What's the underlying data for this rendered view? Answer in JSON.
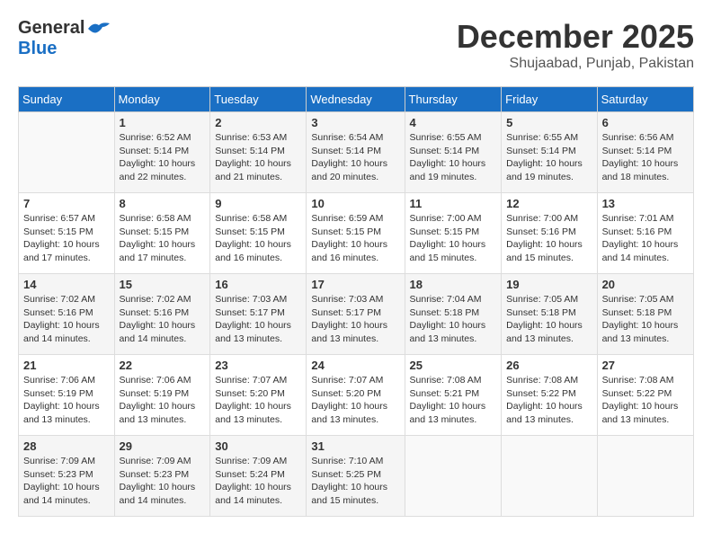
{
  "header": {
    "logo_general": "General",
    "logo_blue": "Blue",
    "month_title": "December 2025",
    "location": "Shujaabad, Punjab, Pakistan"
  },
  "days_of_week": [
    "Sunday",
    "Monday",
    "Tuesday",
    "Wednesday",
    "Thursday",
    "Friday",
    "Saturday"
  ],
  "weeks": [
    [
      {
        "day": "",
        "info": ""
      },
      {
        "day": "1",
        "info": "Sunrise: 6:52 AM\nSunset: 5:14 PM\nDaylight: 10 hours\nand 22 minutes."
      },
      {
        "day": "2",
        "info": "Sunrise: 6:53 AM\nSunset: 5:14 PM\nDaylight: 10 hours\nand 21 minutes."
      },
      {
        "day": "3",
        "info": "Sunrise: 6:54 AM\nSunset: 5:14 PM\nDaylight: 10 hours\nand 20 minutes."
      },
      {
        "day": "4",
        "info": "Sunrise: 6:55 AM\nSunset: 5:14 PM\nDaylight: 10 hours\nand 19 minutes."
      },
      {
        "day": "5",
        "info": "Sunrise: 6:55 AM\nSunset: 5:14 PM\nDaylight: 10 hours\nand 19 minutes."
      },
      {
        "day": "6",
        "info": "Sunrise: 6:56 AM\nSunset: 5:14 PM\nDaylight: 10 hours\nand 18 minutes."
      }
    ],
    [
      {
        "day": "7",
        "info": "Sunrise: 6:57 AM\nSunset: 5:15 PM\nDaylight: 10 hours\nand 17 minutes."
      },
      {
        "day": "8",
        "info": "Sunrise: 6:58 AM\nSunset: 5:15 PM\nDaylight: 10 hours\nand 17 minutes."
      },
      {
        "day": "9",
        "info": "Sunrise: 6:58 AM\nSunset: 5:15 PM\nDaylight: 10 hours\nand 16 minutes."
      },
      {
        "day": "10",
        "info": "Sunrise: 6:59 AM\nSunset: 5:15 PM\nDaylight: 10 hours\nand 16 minutes."
      },
      {
        "day": "11",
        "info": "Sunrise: 7:00 AM\nSunset: 5:15 PM\nDaylight: 10 hours\nand 15 minutes."
      },
      {
        "day": "12",
        "info": "Sunrise: 7:00 AM\nSunset: 5:16 PM\nDaylight: 10 hours\nand 15 minutes."
      },
      {
        "day": "13",
        "info": "Sunrise: 7:01 AM\nSunset: 5:16 PM\nDaylight: 10 hours\nand 14 minutes."
      }
    ],
    [
      {
        "day": "14",
        "info": "Sunrise: 7:02 AM\nSunset: 5:16 PM\nDaylight: 10 hours\nand 14 minutes."
      },
      {
        "day": "15",
        "info": "Sunrise: 7:02 AM\nSunset: 5:16 PM\nDaylight: 10 hours\nand 14 minutes."
      },
      {
        "day": "16",
        "info": "Sunrise: 7:03 AM\nSunset: 5:17 PM\nDaylight: 10 hours\nand 13 minutes."
      },
      {
        "day": "17",
        "info": "Sunrise: 7:03 AM\nSunset: 5:17 PM\nDaylight: 10 hours\nand 13 minutes."
      },
      {
        "day": "18",
        "info": "Sunrise: 7:04 AM\nSunset: 5:18 PM\nDaylight: 10 hours\nand 13 minutes."
      },
      {
        "day": "19",
        "info": "Sunrise: 7:05 AM\nSunset: 5:18 PM\nDaylight: 10 hours\nand 13 minutes."
      },
      {
        "day": "20",
        "info": "Sunrise: 7:05 AM\nSunset: 5:18 PM\nDaylight: 10 hours\nand 13 minutes."
      }
    ],
    [
      {
        "day": "21",
        "info": "Sunrise: 7:06 AM\nSunset: 5:19 PM\nDaylight: 10 hours\nand 13 minutes."
      },
      {
        "day": "22",
        "info": "Sunrise: 7:06 AM\nSunset: 5:19 PM\nDaylight: 10 hours\nand 13 minutes."
      },
      {
        "day": "23",
        "info": "Sunrise: 7:07 AM\nSunset: 5:20 PM\nDaylight: 10 hours\nand 13 minutes."
      },
      {
        "day": "24",
        "info": "Sunrise: 7:07 AM\nSunset: 5:20 PM\nDaylight: 10 hours\nand 13 minutes."
      },
      {
        "day": "25",
        "info": "Sunrise: 7:08 AM\nSunset: 5:21 PM\nDaylight: 10 hours\nand 13 minutes."
      },
      {
        "day": "26",
        "info": "Sunrise: 7:08 AM\nSunset: 5:22 PM\nDaylight: 10 hours\nand 13 minutes."
      },
      {
        "day": "27",
        "info": "Sunrise: 7:08 AM\nSunset: 5:22 PM\nDaylight: 10 hours\nand 13 minutes."
      }
    ],
    [
      {
        "day": "28",
        "info": "Sunrise: 7:09 AM\nSunset: 5:23 PM\nDaylight: 10 hours\nand 14 minutes."
      },
      {
        "day": "29",
        "info": "Sunrise: 7:09 AM\nSunset: 5:23 PM\nDaylight: 10 hours\nand 14 minutes."
      },
      {
        "day": "30",
        "info": "Sunrise: 7:09 AM\nSunset: 5:24 PM\nDaylight: 10 hours\nand 14 minutes."
      },
      {
        "day": "31",
        "info": "Sunrise: 7:10 AM\nSunset: 5:25 PM\nDaylight: 10 hours\nand 15 minutes."
      },
      {
        "day": "",
        "info": ""
      },
      {
        "day": "",
        "info": ""
      },
      {
        "day": "",
        "info": ""
      }
    ]
  ]
}
